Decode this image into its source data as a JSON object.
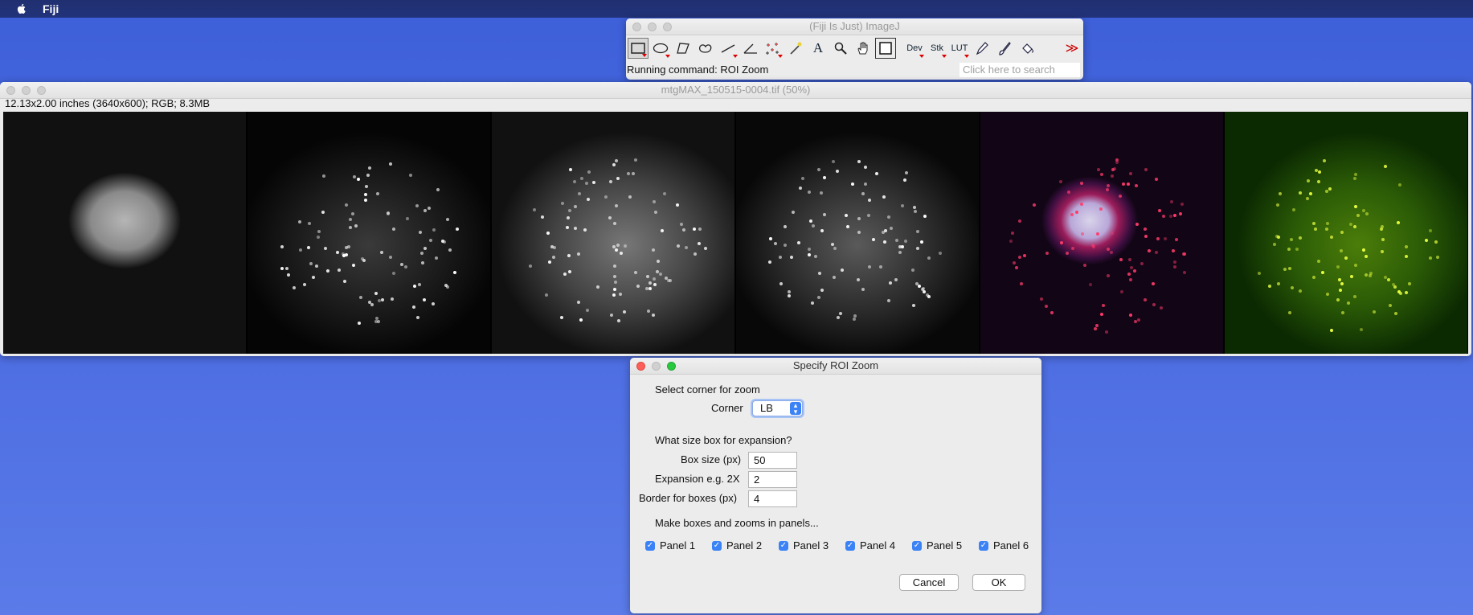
{
  "menubar": {
    "app_name": "Fiji"
  },
  "fiji_window": {
    "title": "(Fiji Is Just) ImageJ",
    "status": "Running command: ROI Zoom",
    "search_placeholder": "Click here to search",
    "tools": [
      {
        "name": "rectangle-tool",
        "label": ""
      },
      {
        "name": "oval-tool",
        "label": ""
      },
      {
        "name": "polygon-tool",
        "label": ""
      },
      {
        "name": "freehand-tool",
        "label": ""
      },
      {
        "name": "line-tool",
        "label": ""
      },
      {
        "name": "angle-tool",
        "label": ""
      },
      {
        "name": "point-tool",
        "label": ""
      },
      {
        "name": "wand-tool",
        "label": ""
      },
      {
        "name": "text-tool",
        "label": "A"
      },
      {
        "name": "magnifier-tool",
        "label": ""
      },
      {
        "name": "hand-tool",
        "label": ""
      },
      {
        "name": "color-picker-tool",
        "label": ""
      },
      {
        "name": "dev-tool",
        "label": "Dev"
      },
      {
        "name": "stk-tool",
        "label": "Stk"
      },
      {
        "name": "lut-tool",
        "label": "LUT"
      },
      {
        "name": "pencil-tool",
        "label": ""
      },
      {
        "name": "brush-tool",
        "label": ""
      },
      {
        "name": "flood-fill-tool",
        "label": ""
      },
      {
        "name": "more-tools",
        "label": "≫"
      }
    ]
  },
  "image_window": {
    "title": "mtgMAX_150515-0004.tif (50%)",
    "info": "12.13x2.00 inches (3640x600); RGB; 8.3MB"
  },
  "dialog": {
    "title": "Specify ROI Zoom",
    "section1": "Select corner for zoom",
    "corner_label": "Corner",
    "corner_value": "LB",
    "section2": "What size box for expansion?",
    "box_size_label": "Box size (px)",
    "box_size_value": "50",
    "expansion_label": "Expansion e.g. 2X",
    "expansion_value": "2",
    "border_label": "Border for boxes (px)",
    "border_value": "4",
    "section3": "Make boxes and zooms in panels...",
    "panels": [
      "Panel 1",
      "Panel 2",
      "Panel 3",
      "Panel 4",
      "Panel 5",
      "Panel 6"
    ],
    "cancel": "Cancel",
    "ok": "OK"
  }
}
